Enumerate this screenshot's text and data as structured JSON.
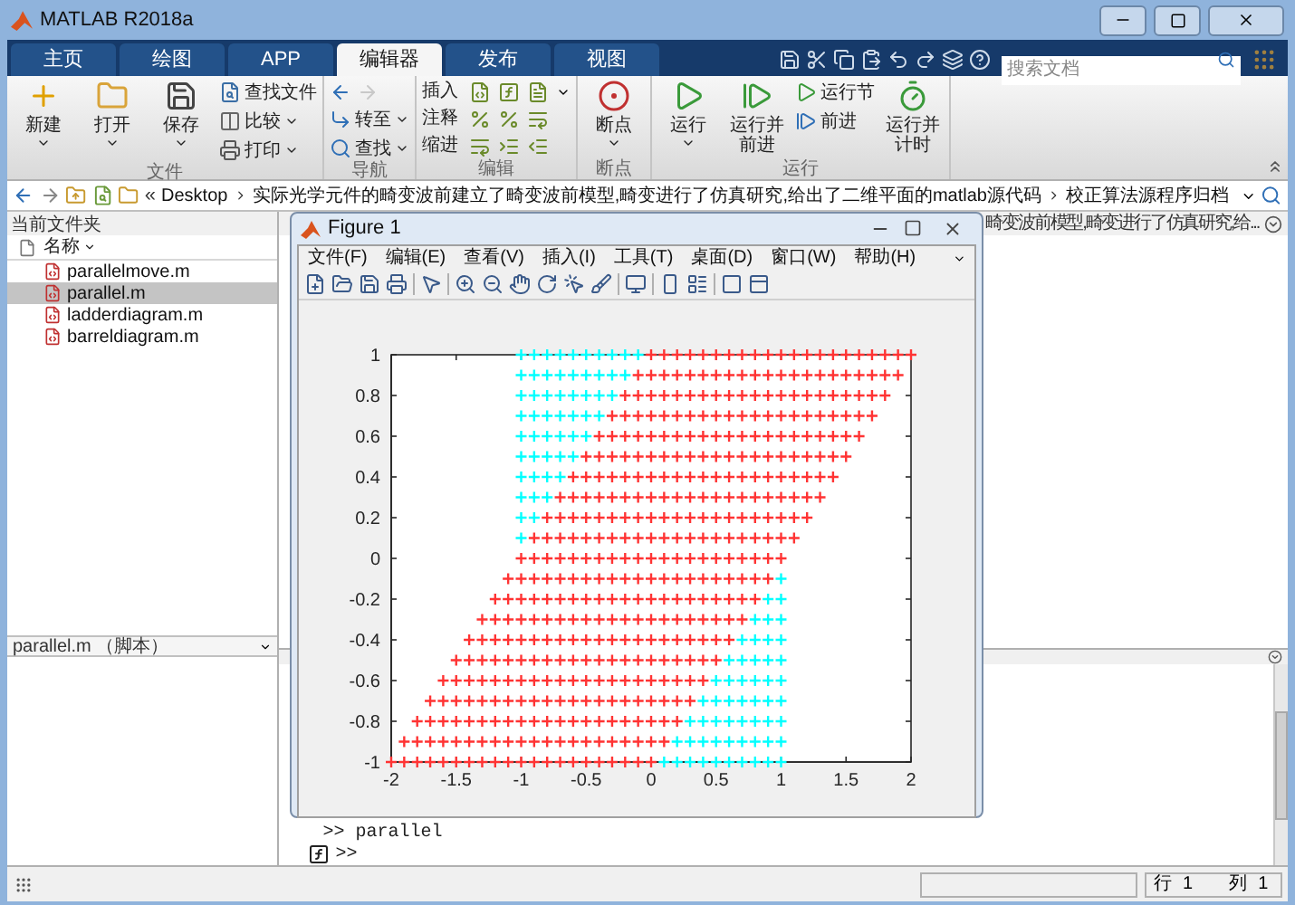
{
  "window": {
    "title": "MATLAB R2018a"
  },
  "tabs": [
    {
      "label": "主页",
      "selected": false
    },
    {
      "label": "绘图",
      "selected": false
    },
    {
      "label": "APP",
      "selected": false
    },
    {
      "label": "编辑器",
      "selected": true
    },
    {
      "label": "发布",
      "selected": false
    },
    {
      "label": "视图",
      "selected": false
    }
  ],
  "doc_search": {
    "placeholder": "搜索文档"
  },
  "ribbon": [
    {
      "label": "文件",
      "items": [
        {
          "kind": "large",
          "label": "新建",
          "dropdown": true
        },
        {
          "kind": "large",
          "label": "打开",
          "dropdown": true
        },
        {
          "kind": "large",
          "label": "保存",
          "dropdown": true
        },
        {
          "kind": "small",
          "label": "查找文件",
          "dropdown": false
        },
        {
          "kind": "small",
          "label": "比较",
          "dropdown": true
        },
        {
          "kind": "small",
          "label": "打印",
          "dropdown": true
        }
      ]
    },
    {
      "label": "导航",
      "items": [
        {
          "kind": "arrows",
          "back_disabled": false,
          "forward_disabled": true
        },
        {
          "kind": "small",
          "label": "转至",
          "dropdown": true
        },
        {
          "kind": "small",
          "label": "查找",
          "dropdown": true
        }
      ]
    },
    {
      "label": "编辑",
      "items": [
        {
          "kind": "tools",
          "label": "插入",
          "dropdown": true
        },
        {
          "kind": "tools",
          "label": "注释",
          "dropdown": false
        },
        {
          "kind": "tools",
          "label": "缩进",
          "dropdown": false
        }
      ]
    },
    {
      "label": "断点",
      "items": [
        {
          "kind": "large",
          "label": "断点",
          "dropdown": true
        }
      ]
    },
    {
      "label": "运行",
      "items": [
        {
          "kind": "large",
          "label": "运行",
          "dropdown": true
        },
        {
          "kind": "large",
          "label": "运行并前进",
          "dropdown": false
        },
        {
          "kind": "small",
          "label": "运行节",
          "dropdown": false
        },
        {
          "kind": "small",
          "label": "前进",
          "dropdown": false
        },
        {
          "kind": "large",
          "label": "运行并计时",
          "dropdown": false
        }
      ]
    }
  ],
  "address_bar": {
    "prefix": "«",
    "segments": [
      "Desktop",
      "实际光学元件的畸变波前建立了畸变波前模型,畸变进行了仿真研究,给出了二维平面的matlab源代码",
      "校正算法源程序归档"
    ]
  },
  "current_folder": {
    "title": "当前文件夹",
    "column": "名称",
    "files": [
      {
        "name": "parallelmove.m",
        "selected": false
      },
      {
        "name": "parallel.m",
        "selected": true
      },
      {
        "name": "ladderdiagram.m",
        "selected": false
      },
      {
        "name": "barreldiagram.m",
        "selected": false
      }
    ],
    "details": "parallel.m （脚本）"
  },
  "editor": {
    "title": "畸变波前模型,畸变进行了仿真研究,给..."
  },
  "command_window": {
    "history": ">> parallel",
    "prompt": ">>"
  },
  "status_bar": {
    "row_label": "行",
    "row": "1",
    "col_label": "列",
    "col": "1"
  },
  "figure": {
    "title": "Figure 1",
    "menu": [
      "文件(F)",
      "编辑(E)",
      "查看(V)",
      "插入(I)",
      "工具(T)",
      "桌面(D)",
      "窗口(W)",
      "帮助(H)"
    ],
    "chart_data": {
      "type": "scatter",
      "xlim": [
        -2,
        2
      ],
      "ylim": [
        -1,
        1
      ],
      "xticks": [
        -2,
        -1.5,
        -1,
        -0.5,
        0,
        0.5,
        1,
        1.5,
        2
      ],
      "yticks": [
        -1,
        -0.8,
        -0.6,
        -0.4,
        -0.2,
        0,
        0.2,
        0.4,
        0.6,
        0.8,
        1
      ],
      "series": [
        {
          "color": "#00ffff",
          "x": [
            -1,
            -0.9,
            -0.8,
            -0.7,
            -0.6,
            -0.5,
            -0.4,
            -0.3,
            -0.2,
            -0.1,
            -1,
            -0.9,
            -0.8,
            -0.7,
            -0.6,
            -0.5,
            -0.4,
            -0.3,
            -0.2,
            -1,
            -0.9,
            -0.8,
            -0.7,
            -0.6,
            -0.5,
            -0.4,
            -0.3,
            -1,
            -0.9,
            -0.8,
            -0.7,
            -0.6,
            -0.5,
            -0.4,
            -1,
            -0.9,
            -0.8,
            -0.7,
            -0.6,
            -0.5,
            -1,
            -0.9,
            -0.8,
            -0.7,
            -0.6,
            -1,
            -0.9,
            -0.8,
            -0.7,
            -1,
            -0.9,
            -0.8,
            -1,
            -0.9,
            -1,
            1,
            0.9,
            1,
            0.8,
            0.9,
            1,
            0.7,
            0.8,
            0.9,
            1,
            0.6,
            0.7,
            0.8,
            0.9,
            1,
            0.5,
            0.6,
            0.7,
            0.8,
            0.9,
            1,
            0.4,
            0.5,
            0.6,
            0.7,
            0.8,
            0.9,
            1,
            0.3,
            0.4,
            0.5,
            0.6,
            0.7,
            0.8,
            0.9,
            1,
            0.2,
            0.3,
            0.4,
            0.5,
            0.6,
            0.7,
            0.8,
            0.9,
            1,
            0.1,
            0.2,
            0.3,
            0.4,
            0.5,
            0.6,
            0.7,
            0.8,
            0.9,
            1
          ],
          "values": [
            1,
            1,
            1,
            1,
            1,
            1,
            1,
            1,
            1,
            1,
            0.9,
            0.9,
            0.9,
            0.9,
            0.9,
            0.9,
            0.9,
            0.9,
            0.9,
            0.8,
            0.8,
            0.8,
            0.8,
            0.8,
            0.8,
            0.8,
            0.8,
            0.7,
            0.7,
            0.7,
            0.7,
            0.7,
            0.7,
            0.7,
            0.6,
            0.6,
            0.6,
            0.6,
            0.6,
            0.6,
            0.5,
            0.5,
            0.5,
            0.5,
            0.5,
            0.4,
            0.4,
            0.4,
            0.4,
            0.3,
            0.3,
            0.3,
            0.2,
            0.2,
            0.1,
            -0.1,
            -0.2,
            -0.2,
            -0.3,
            -0.3,
            -0.3,
            -0.4,
            -0.4,
            -0.4,
            -0.4,
            -0.5,
            -0.5,
            -0.5,
            -0.5,
            -0.5,
            -0.6,
            -0.6,
            -0.6,
            -0.6,
            -0.6,
            -0.6,
            -0.7,
            -0.7,
            -0.7,
            -0.7,
            -0.7,
            -0.7,
            -0.7,
            -0.8,
            -0.8,
            -0.8,
            -0.8,
            -0.8,
            -0.8,
            -0.8,
            -0.8,
            -0.9,
            -0.9,
            -0.9,
            -0.9,
            -0.9,
            -0.9,
            -0.9,
            -0.9,
            -0.9,
            -1,
            -1,
            -1,
            -1,
            -1,
            -1,
            -1,
            -1,
            -1,
            -1
          ]
        },
        {
          "color": "#ff3333",
          "x": [
            0,
            0.1,
            0.2,
            0.3,
            0.4,
            0.5,
            0.6,
            0.7,
            0.8,
            0.9,
            1,
            1.1,
            1.2,
            1.3,
            1.4,
            1.5,
            1.6,
            1.7,
            1.8,
            1.9,
            2,
            -0.1,
            0,
            0.1,
            0.2,
            0.3,
            0.4,
            0.5,
            0.6,
            0.7,
            0.8,
            0.9,
            1,
            1.1,
            1.2,
            1.3,
            1.4,
            1.5,
            1.6,
            1.7,
            1.8,
            1.9,
            -0.2,
            -0.1,
            0,
            0.1,
            0.2,
            0.3,
            0.4,
            0.5,
            0.6,
            0.7,
            0.8,
            0.9,
            1,
            1.1,
            1.2,
            1.3,
            1.4,
            1.5,
            1.6,
            1.7,
            1.8,
            -0.3,
            -0.2,
            -0.1,
            0,
            0.1,
            0.2,
            0.3,
            0.4,
            0.5,
            0.6,
            0.7,
            0.8,
            0.9,
            1,
            1.1,
            1.2,
            1.3,
            1.4,
            1.5,
            1.6,
            1.7,
            -0.4,
            -0.3,
            -0.2,
            -0.1,
            0,
            0.1,
            0.2,
            0.3,
            0.4,
            0.5,
            0.6,
            0.7,
            0.8,
            0.9,
            1,
            1.1,
            1.2,
            1.3,
            1.4,
            1.5,
            1.6,
            -0.5,
            -0.4,
            -0.3,
            -0.2,
            -0.1,
            0,
            0.1,
            0.2,
            0.3,
            0.4,
            0.5,
            0.6,
            0.7,
            0.8,
            0.9,
            1,
            1.1,
            1.2,
            1.3,
            1.4,
            1.5,
            -0.6,
            -0.5,
            -0.4,
            -0.3,
            -0.2,
            -0.1,
            0,
            0.1,
            0.2,
            0.3,
            0.4,
            0.5,
            0.6,
            0.7,
            0.8,
            0.9,
            1,
            1.1,
            1.2,
            1.3,
            1.4,
            -0.7,
            -0.6,
            -0.5,
            -0.4,
            -0.3,
            -0.2,
            -0.1,
            0,
            0.1,
            0.2,
            0.3,
            0.4,
            0.5,
            0.6,
            0.7,
            0.8,
            0.9,
            1,
            1.1,
            1.2,
            1.3,
            -0.8,
            -0.7,
            -0.6,
            -0.5,
            -0.4,
            -0.3,
            -0.2,
            -0.1,
            0,
            0.1,
            0.2,
            0.3,
            0.4,
            0.5,
            0.6,
            0.7,
            0.8,
            0.9,
            1,
            1.1,
            1.2,
            -0.9,
            -0.8,
            -0.7,
            -0.6,
            -0.5,
            -0.4,
            -0.3,
            -0.2,
            -0.1,
            0,
            0.1,
            0.2,
            0.3,
            0.4,
            0.5,
            0.6,
            0.7,
            0.8,
            0.9,
            1,
            1.1,
            -1,
            -0.9,
            -0.8,
            -0.7,
            -0.6,
            -0.5,
            -0.4,
            -0.3,
            -0.2,
            -0.1,
            0,
            0.1,
            0.2,
            0.3,
            0.4,
            0.5,
            0.6,
            0.7,
            0.8,
            0.9,
            1,
            -1.1,
            -1,
            -0.9,
            -0.8,
            -0.7,
            -0.6,
            -0.5,
            -0.4,
            -0.3,
            -0.2,
            -0.1,
            0,
            0.1,
            0.2,
            0.3,
            0.4,
            0.5,
            0.6,
            0.7,
            0.8,
            0.9,
            -1.2,
            -1.1,
            -1,
            -0.9,
            -0.8,
            -0.7,
            -0.6,
            -0.5,
            -0.4,
            -0.3,
            -0.2,
            -0.1,
            0,
            0.1,
            0.2,
            0.3,
            0.4,
            0.5,
            0.6,
            0.7,
            0.8,
            -1.3,
            -1.2,
            -1.1,
            -1,
            -0.9,
            -0.8,
            -0.7,
            -0.6,
            -0.5,
            -0.4,
            -0.3,
            -0.2,
            -0.1,
            0,
            0.1,
            0.2,
            0.3,
            0.4,
            0.5,
            0.6,
            0.7,
            -1.4,
            -1.3,
            -1.2,
            -1.1,
            -1,
            -0.9,
            -0.8,
            -0.7,
            -0.6,
            -0.5,
            -0.4,
            -0.3,
            -0.2,
            -0.1,
            0,
            0.1,
            0.2,
            0.3,
            0.4,
            0.5,
            0.6,
            -1.5,
            -1.4,
            -1.3,
            -1.2,
            -1.1,
            -1,
            -0.9,
            -0.8,
            -0.7,
            -0.6,
            -0.5,
            -0.4,
            -0.3,
            -0.2,
            -0.1,
            0,
            0.1,
            0.2,
            0.3,
            0.4,
            0.5,
            -1.6,
            -1.5,
            -1.4,
            -1.3,
            -1.2,
            -1.1,
            -1,
            -0.9,
            -0.8,
            -0.7,
            -0.6,
            -0.5,
            -0.4,
            -0.3,
            -0.2,
            -0.1,
            0,
            0.1,
            0.2,
            0.3,
            0.4,
            -1.7,
            -1.6,
            -1.5,
            -1.4,
            -1.3,
            -1.2,
            -1.1,
            -1,
            -0.9,
            -0.8,
            -0.7,
            -0.6,
            -0.5,
            -0.4,
            -0.3,
            -0.2,
            -0.1,
            0,
            0.1,
            0.2,
            0.3,
            -1.8,
            -1.7,
            -1.6,
            -1.5,
            -1.4,
            -1.3,
            -1.2,
            -1.1,
            -1,
            -0.9,
            -0.8,
            -0.7,
            -0.6,
            -0.5,
            -0.4,
            -0.3,
            -0.2,
            -0.1,
            0,
            0.1,
            0.2,
            -1.9,
            -1.8,
            -1.7,
            -1.6,
            -1.5,
            -1.4,
            -1.3,
            -1.2,
            -1.1,
            -1,
            -0.9,
            -0.8,
            -0.7,
            -0.6,
            -0.5,
            -0.4,
            -0.3,
            -0.2,
            -0.1,
            0,
            0.1,
            -2,
            -1.9,
            -1.8,
            -1.7,
            -1.6,
            -1.5,
            -1.4,
            -1.3,
            -1.2,
            -1.1,
            -1,
            -0.9,
            -0.8,
            -0.7,
            -0.6,
            -0.5,
            -0.4,
            -0.3,
            -0.2,
            -0.1,
            0
          ],
          "values": [
            1,
            1,
            1,
            1,
            1,
            1,
            1,
            1,
            1,
            1,
            1,
            1,
            1,
            1,
            1,
            1,
            1,
            1,
            1,
            1,
            1,
            0.9,
            0.9,
            0.9,
            0.9,
            0.9,
            0.9,
            0.9,
            0.9,
            0.9,
            0.9,
            0.9,
            0.9,
            0.9,
            0.9,
            0.9,
            0.9,
            0.9,
            0.9,
            0.9,
            0.9,
            0.9,
            0.8,
            0.8,
            0.8,
            0.8,
            0.8,
            0.8,
            0.8,
            0.8,
            0.8,
            0.8,
            0.8,
            0.8,
            0.8,
            0.8,
            0.8,
            0.8,
            0.8,
            0.8,
            0.8,
            0.8,
            0.8,
            0.7,
            0.7,
            0.7,
            0.7,
            0.7,
            0.7,
            0.7,
            0.7,
            0.7,
            0.7,
            0.7,
            0.7,
            0.7,
            0.7,
            0.7,
            0.7,
            0.7,
            0.7,
            0.7,
            0.7,
            0.7,
            0.6,
            0.6,
            0.6,
            0.6,
            0.6,
            0.6,
            0.6,
            0.6,
            0.6,
            0.6,
            0.6,
            0.6,
            0.6,
            0.6,
            0.6,
            0.6,
            0.6,
            0.6,
            0.6,
            0.6,
            0.6,
            0.5,
            0.5,
            0.5,
            0.5,
            0.5,
            0.5,
            0.5,
            0.5,
            0.5,
            0.5,
            0.5,
            0.5,
            0.5,
            0.5,
            0.5,
            0.5,
            0.5,
            0.5,
            0.5,
            0.5,
            0.5,
            0.4,
            0.4,
            0.4,
            0.4,
            0.4,
            0.4,
            0.4,
            0.4,
            0.4,
            0.4,
            0.4,
            0.4,
            0.4,
            0.4,
            0.4,
            0.4,
            0.4,
            0.4,
            0.4,
            0.4,
            0.4,
            0.3,
            0.3,
            0.3,
            0.3,
            0.3,
            0.3,
            0.3,
            0.3,
            0.3,
            0.3,
            0.3,
            0.3,
            0.3,
            0.3,
            0.3,
            0.3,
            0.3,
            0.3,
            0.3,
            0.3,
            0.3,
            0.2,
            0.2,
            0.2,
            0.2,
            0.2,
            0.2,
            0.2,
            0.2,
            0.2,
            0.2,
            0.2,
            0.2,
            0.2,
            0.2,
            0.2,
            0.2,
            0.2,
            0.2,
            0.2,
            0.2,
            0.2,
            0.1,
            0.1,
            0.1,
            0.1,
            0.1,
            0.1,
            0.1,
            0.1,
            0.1,
            0.1,
            0.1,
            0.1,
            0.1,
            0.1,
            0.1,
            0.1,
            0.1,
            0.1,
            0.1,
            0.1,
            0.1,
            0,
            0,
            0,
            0,
            0,
            0,
            0,
            0,
            0,
            0,
            0,
            0,
            0,
            0,
            0,
            0,
            0,
            0,
            0,
            0,
            0,
            -0.1,
            -0.1,
            -0.1,
            -0.1,
            -0.1,
            -0.1,
            -0.1,
            -0.1,
            -0.1,
            -0.1,
            -0.1,
            -0.1,
            -0.1,
            -0.1,
            -0.1,
            -0.1,
            -0.1,
            -0.1,
            -0.1,
            -0.1,
            -0.1,
            -0.2,
            -0.2,
            -0.2,
            -0.2,
            -0.2,
            -0.2,
            -0.2,
            -0.2,
            -0.2,
            -0.2,
            -0.2,
            -0.2,
            -0.2,
            -0.2,
            -0.2,
            -0.2,
            -0.2,
            -0.2,
            -0.2,
            -0.2,
            -0.2,
            -0.3,
            -0.3,
            -0.3,
            -0.3,
            -0.3,
            -0.3,
            -0.3,
            -0.3,
            -0.3,
            -0.3,
            -0.3,
            -0.3,
            -0.3,
            -0.3,
            -0.3,
            -0.3,
            -0.3,
            -0.3,
            -0.3,
            -0.3,
            -0.3,
            -0.4,
            -0.4,
            -0.4,
            -0.4,
            -0.4,
            -0.4,
            -0.4,
            -0.4,
            -0.4,
            -0.4,
            -0.4,
            -0.4,
            -0.4,
            -0.4,
            -0.4,
            -0.4,
            -0.4,
            -0.4,
            -0.4,
            -0.4,
            -0.4,
            -0.5,
            -0.5,
            -0.5,
            -0.5,
            -0.5,
            -0.5,
            -0.5,
            -0.5,
            -0.5,
            -0.5,
            -0.5,
            -0.5,
            -0.5,
            -0.5,
            -0.5,
            -0.5,
            -0.5,
            -0.5,
            -0.5,
            -0.5,
            -0.5,
            -0.6,
            -0.6,
            -0.6,
            -0.6,
            -0.6,
            -0.6,
            -0.6,
            -0.6,
            -0.6,
            -0.6,
            -0.6,
            -0.6,
            -0.6,
            -0.6,
            -0.6,
            -0.6,
            -0.6,
            -0.6,
            -0.6,
            -0.6,
            -0.6,
            -0.7,
            -0.7,
            -0.7,
            -0.7,
            -0.7,
            -0.7,
            -0.7,
            -0.7,
            -0.7,
            -0.7,
            -0.7,
            -0.7,
            -0.7,
            -0.7,
            -0.7,
            -0.7,
            -0.7,
            -0.7,
            -0.7,
            -0.7,
            -0.7,
            -0.8,
            -0.8,
            -0.8,
            -0.8,
            -0.8,
            -0.8,
            -0.8,
            -0.8,
            -0.8,
            -0.8,
            -0.8,
            -0.8,
            -0.8,
            -0.8,
            -0.8,
            -0.8,
            -0.8,
            -0.8,
            -0.8,
            -0.8,
            -0.8,
            -0.9,
            -0.9,
            -0.9,
            -0.9,
            -0.9,
            -0.9,
            -0.9,
            -0.9,
            -0.9,
            -0.9,
            -0.9,
            -0.9,
            -0.9,
            -0.9,
            -0.9,
            -0.9,
            -0.9,
            -0.9,
            -0.9,
            -0.9,
            -0.9,
            -1,
            -1,
            -1,
            -1,
            -1,
            -1,
            -1,
            -1,
            -1,
            -1,
            -1,
            -1,
            -1,
            -1,
            -1,
            -1,
            -1,
            -1,
            -1,
            -1,
            -1
          ]
        }
      ]
    }
  }
}
